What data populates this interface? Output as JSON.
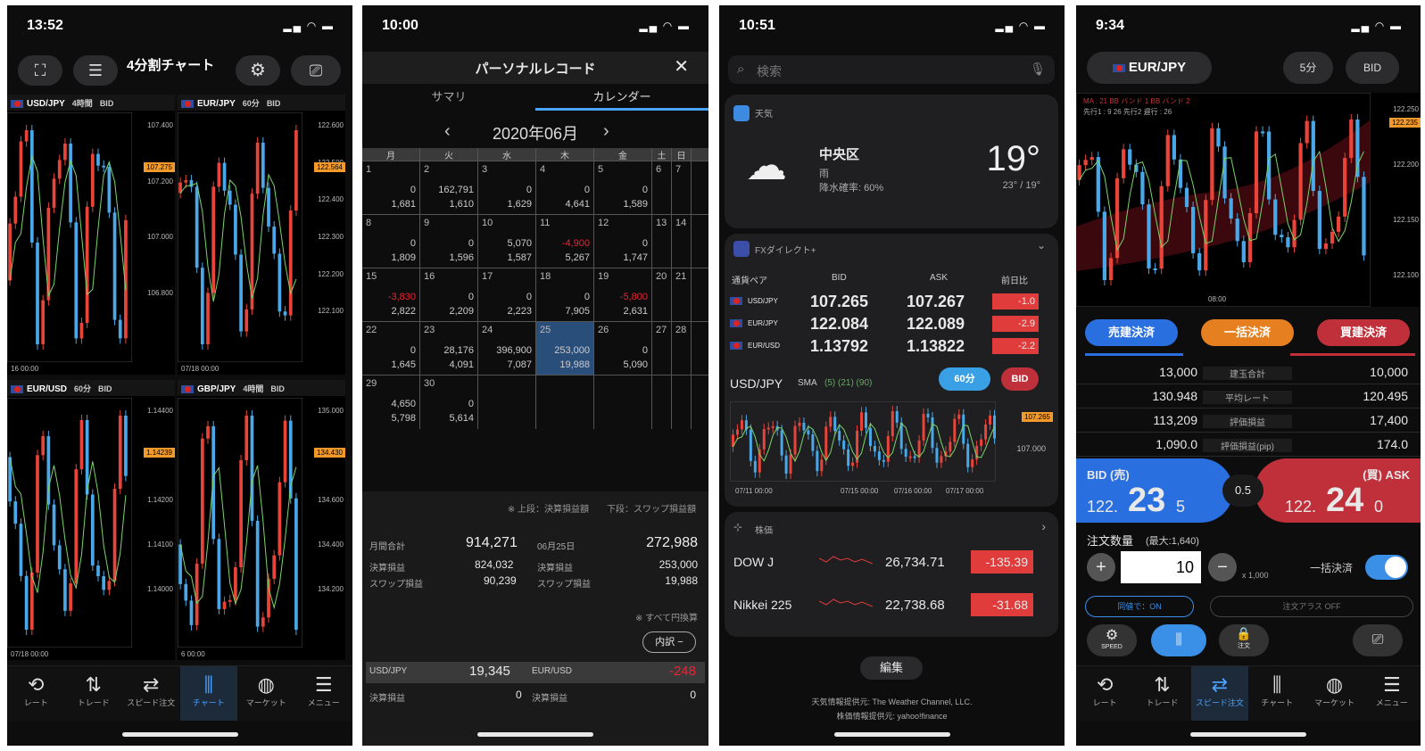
{
  "p1": {
    "time": "13:52",
    "title": "4分割チャート",
    "cells": [
      {
        "pair": "USD/JPY",
        "tf": "4時間",
        "bid": "BID",
        "ticks": [
          "107.400",
          "107.200",
          "107.000",
          "106.800"
        ],
        "tag": "107.275",
        "date": "16 00:00"
      },
      {
        "pair": "EUR/JPY",
        "tf": "60分",
        "bid": "BID",
        "ticks": [
          "122.600",
          "122.500",
          "122.400",
          "122.300",
          "122.200",
          "122.100"
        ],
        "tag": "122.564",
        "date": "07/18 00:00"
      },
      {
        "pair": "EUR/USD",
        "tf": "60分",
        "bid": "BID",
        "ticks": [
          "1.14400",
          "1.14300",
          "1.14200",
          "1.14100",
          "1.14000"
        ],
        "tag": "1.14239",
        "date": "07/18 00:00"
      },
      {
        "pair": "GBP/JPY",
        "tf": "4時間",
        "bid": "BID",
        "ticks": [
          "135.000",
          "134.800",
          "134.600",
          "134.400",
          "134.200"
        ],
        "tag": "134.430",
        "date": "6 00:00"
      }
    ],
    "tabs": [
      "レート",
      "トレード",
      "スピード注文",
      "チャート",
      "マーケット",
      "メニュー"
    ]
  },
  "p2": {
    "time": "10:00",
    "title": "パーソナルレコード",
    "close": "✕",
    "tab1": "サマリ",
    "tab2": "カレンダー",
    "month": "2020年06月",
    "weekdays": [
      "月",
      "火",
      "水",
      "木",
      "金",
      "土",
      "日"
    ],
    "weeks": [
      [
        [
          "1",
          "0",
          "1,681"
        ],
        [
          "2",
          "162,791",
          "1,610"
        ],
        [
          "3",
          "0",
          "1,629"
        ],
        [
          "4",
          "0",
          "4,641"
        ],
        [
          "5",
          "0",
          "1,589"
        ],
        [
          "6",
          "",
          ""
        ],
        [
          "7",
          "",
          ""
        ]
      ],
      [
        [
          "8",
          "0",
          "1,809"
        ],
        [
          "9",
          "0",
          "1,596"
        ],
        [
          "10",
          "5,070",
          "1,587"
        ],
        [
          "11",
          "-4,900",
          "5,267"
        ],
        [
          "12",
          "0",
          "1,747"
        ],
        [
          "13",
          "",
          ""
        ],
        [
          "14",
          "",
          ""
        ]
      ],
      [
        [
          "15",
          "-3,830",
          "2,822"
        ],
        [
          "16",
          "0",
          "2,209"
        ],
        [
          "17",
          "0",
          "2,223"
        ],
        [
          "18",
          "0",
          "7,905"
        ],
        [
          "19",
          "-5,800",
          "2,631"
        ],
        [
          "20",
          "",
          ""
        ],
        [
          "21",
          "",
          ""
        ]
      ],
      [
        [
          "22",
          "0",
          "1,645"
        ],
        [
          "23",
          "28,176",
          "4,091"
        ],
        [
          "24",
          "396,900",
          "7,087"
        ],
        [
          "25",
          "253,000",
          "19,988"
        ],
        [
          "26",
          "0",
          "5,090"
        ],
        [
          "27",
          "",
          ""
        ],
        [
          "28",
          "",
          ""
        ]
      ],
      [
        [
          "29",
          "4,650",
          "5,798"
        ],
        [
          "30",
          "0",
          "5,614"
        ],
        [
          "",
          "",
          ""
        ],
        [
          "",
          "",
          ""
        ],
        [
          "",
          "",
          ""
        ],
        [
          "",
          "",
          ""
        ],
        [
          "",
          "",
          ""
        ]
      ]
    ],
    "legend": "※ 上段：決算損益額　　下段：スワップ損益額",
    "monthTotalL": "月間合計",
    "monthTotal": "914,271",
    "dayL": "06月25日",
    "dayTotal": "272,988",
    "r1l": "決算損益",
    "r1v": "824,032",
    "r1r": "決算損益",
    "r1rv": "253,000",
    "r2l": "スワップ損益",
    "r2v": "90,239",
    "r2r": "スワップ損益",
    "r2rv": "19,988",
    "note": "※ すべて円換算",
    "btn": "内訳 −",
    "b1": "USD/JPY",
    "b1v": "19,345",
    "b2": "EUR/USD",
    "b2v": "-248",
    "b3": "決算損益",
    "b3v": "0",
    "b4": "決算損益",
    "b4v": "0"
  },
  "p3": {
    "time": "10:51",
    "search": "検索",
    "weather": "天気",
    "city": "中央区",
    "cond": "雨",
    "rain": "降水確率: 60%",
    "temp": "19°",
    "hilo": "23° / 19°",
    "fx": "FXダイレクト+",
    "cols": [
      "通貨ペア",
      "BID",
      "ASK",
      "前日比"
    ],
    "rates": [
      [
        "USD/JPY",
        "107.265",
        "107.267",
        "-1.0"
      ],
      [
        "EUR/JPY",
        "122.084",
        "122.089",
        "-2.9"
      ],
      [
        "EUR/USD",
        "1.13792",
        "1.13822",
        "-2.2"
      ]
    ],
    "chartPair": "USD/JPY",
    "sma": "SMA",
    "smaV": "(5) (21) (90)",
    "tf": "60分",
    "bid": "BID",
    "tag": "107.265",
    "ytick": "107.000",
    "dates": [
      "07/11 00:00",
      "07/15 00:00",
      "07/16 00:00",
      "07/17 00:00"
    ],
    "stocks": "株価",
    "idx": [
      [
        "DOW J",
        "26,734.71",
        "-135.39"
      ],
      [
        "Nikkei 225",
        "22,738.68",
        "-31.68"
      ]
    ],
    "edit": "編集",
    "credit1": "天気情報提供元: The Weather Channel, LLC.",
    "credit2": "株価情報提供元: yahoo!finance"
  },
  "p4": {
    "time": "9:34",
    "pair": "EUR/JPY",
    "tf": "5分",
    "bid": "BID",
    "ma": "MA : 21 BB バンド 1 BB バンド 2",
    "ichi": "先行1 : 9 26 先行2 遅行 : 26",
    "ticks": [
      "122.250",
      "122.200",
      "122.150",
      "122.100"
    ],
    "tag": "122.235",
    "time0": "08:00",
    "b1": "売建決済",
    "b2": "一括決済",
    "b3": "買建決済",
    "rows": [
      [
        "13,000",
        "建玉合計",
        "10,000"
      ],
      [
        "130.948",
        "平均レート",
        "120.495"
      ],
      [
        "113,209",
        "評価損益",
        "17,400"
      ],
      [
        "1,090.0",
        "評価損益(pip)",
        "174.0"
      ]
    ],
    "bidL": "BID (売)",
    "bidP": "122.",
    "bidB": "23",
    "bidS": "5",
    "spread": "0.5",
    "askL": "(買) ASK",
    "askP": "122.",
    "askB": "24",
    "askS": "0",
    "qtyL": "注文数量",
    "qtyMax": "(最大:1,640)",
    "qty": "10",
    "unit": "x 1,000",
    "bulk": "一括決済",
    "opt1": "同値で：ON",
    "opt2": "注文アラス OFF",
    "tabs": [
      "レート",
      "トレード",
      "スピード注文",
      "チャート",
      "マーケット",
      "メニュー"
    ],
    "tool": [
      "SPEED",
      "注文"
    ]
  }
}
